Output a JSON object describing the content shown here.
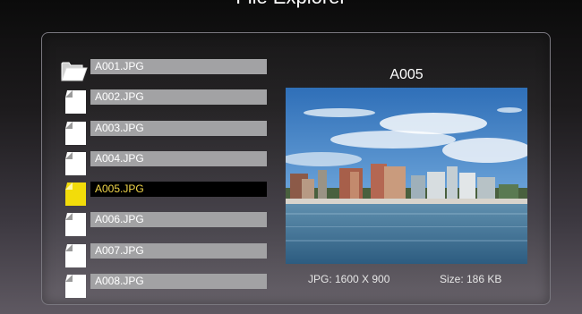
{
  "header": {
    "title": "File Explorer"
  },
  "files": [
    {
      "name": "A001.JPG",
      "icon": "folder-icon",
      "selected": false
    },
    {
      "name": "A002.JPG",
      "icon": "file-icon",
      "selected": false
    },
    {
      "name": "A003.JPG",
      "icon": "file-icon",
      "selected": false
    },
    {
      "name": "A004.JPG",
      "icon": "file-icon",
      "selected": false
    },
    {
      "name": "A005.JPG",
      "icon": "file-icon",
      "selected": true
    },
    {
      "name": "A006.JPG",
      "icon": "file-icon",
      "selected": false
    },
    {
      "name": "A007.JPG",
      "icon": "file-icon",
      "selected": false
    },
    {
      "name": "A008.JPG",
      "icon": "file-icon",
      "selected": false
    }
  ],
  "preview": {
    "title": "A005",
    "resolution": "JPG: 1600 X 900",
    "size": "Size: 186 KB"
  },
  "colors": {
    "selected_text": "#f2d64a",
    "selected_icon": "#f2dc0a",
    "bar": "#a2a2a4"
  }
}
